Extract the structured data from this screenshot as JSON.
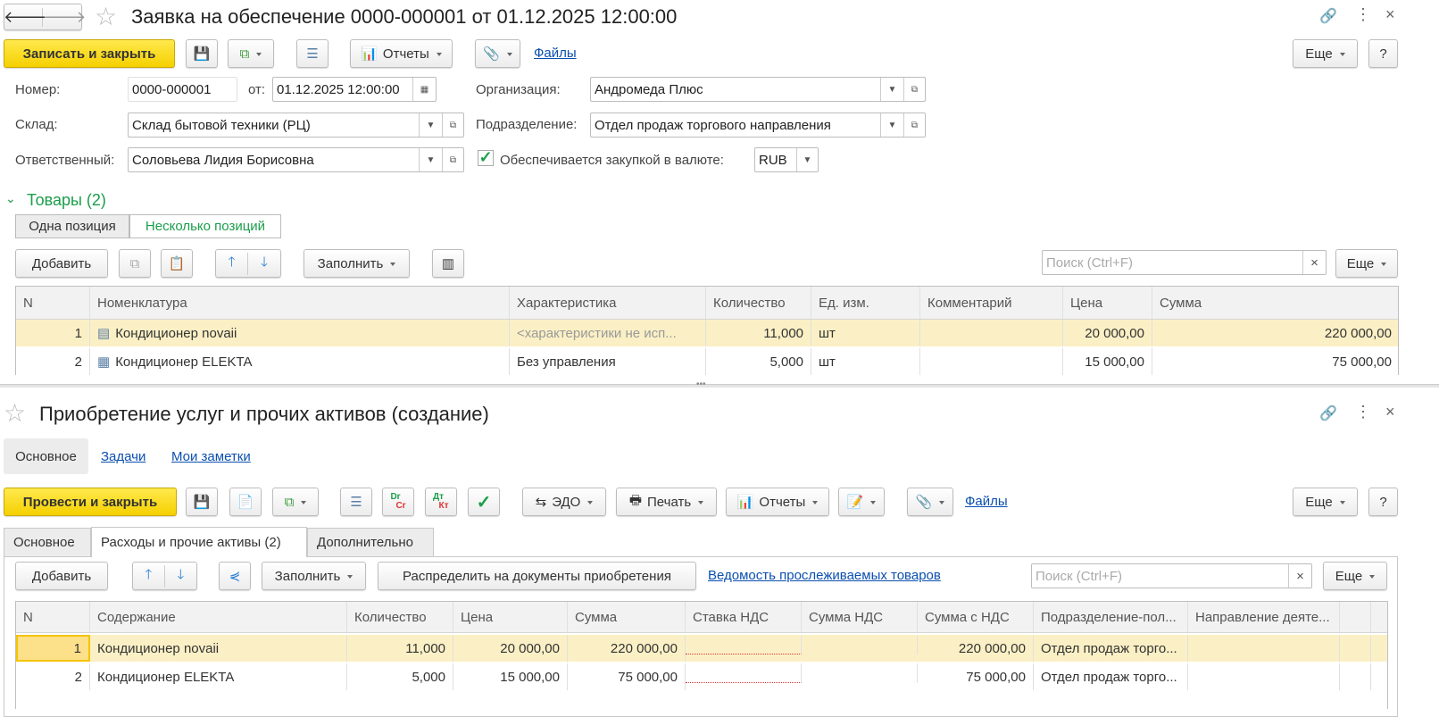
{
  "top": {
    "title": "Заявка на обеспечение 0000-000001 от 01.12.2025 12:00:00",
    "save_close": "Записать и закрыть",
    "reports": "Отчеты",
    "files": "Файлы",
    "more": "Еще",
    "help": "?",
    "fields": {
      "number_label": "Номер:",
      "number": "0000-000001",
      "from_label": "от:",
      "date": "01.12.2025 12:00:00",
      "org_label": "Организация:",
      "org": "Андромеда Плюс",
      "warehouse_label": "Склад:",
      "warehouse": "Склад бытовой техники (РЦ)",
      "dept_label": "Подразделение:",
      "dept": "Отдел продаж торгового направления",
      "resp_label": "Ответственный:",
      "resp": "Соловьева Лидия Борисовна",
      "purchase_label": "Обеспечивается закупкой в валюте:",
      "currency": "RUB"
    },
    "goods_title": "Товары (2)",
    "mode_one": "Одна позиция",
    "mode_many": "Несколько позиций",
    "add": "Добавить",
    "fill": "Заполнить",
    "search_placeholder": "Поиск (Ctrl+F)",
    "clear": "×",
    "columns": [
      "N",
      "Номенклатура",
      "Характеристика",
      "Количество",
      "Ед. изм.",
      "Комментарий",
      "Цена",
      "Сумма"
    ],
    "rows": [
      {
        "n": "1",
        "name": "Кондиционер novaii",
        "char": "<характеристики не исп...",
        "qty": "11,000",
        "unit": "шт",
        "comment": "",
        "price": "20 000,00",
        "sum": "220 000,00"
      },
      {
        "n": "2",
        "name": "Кондиционер ELEKTA",
        "char": "Без управления",
        "qty": "5,000",
        "unit": "шт",
        "comment": "",
        "price": "15 000,00",
        "sum": "75 000,00"
      }
    ]
  },
  "bottom": {
    "title": "Приобретение услуг и прочих активов (создание)",
    "sections": [
      "Основное",
      "Задачи",
      "Мои заметки"
    ],
    "post_close": "Провести и закрыть",
    "edo": "ЭДО",
    "print": "Печать",
    "reports": "Отчеты",
    "files": "Файлы",
    "more": "Еще",
    "help": "?",
    "drcr": {
      "a": "Dr",
      "b": "Cr"
    },
    "dtkt": {
      "a": "Дт",
      "b": "Кт"
    },
    "tabs": [
      "Основное",
      "Расходы и прочие активы (2)",
      "Дополнительно"
    ],
    "add": "Добавить",
    "fill": "Заполнить",
    "distribute": "Распределить на документы приобретения",
    "tracked_link": "Ведомость прослеживаемых товаров",
    "search_placeholder": "Поиск (Ctrl+F)",
    "clear": "×",
    "columns": [
      "N",
      "Содержание",
      "Количество",
      "Цена",
      "Сумма",
      "Ставка НДС",
      "Сумма НДС",
      "Сумма с НДС",
      "Подразделение-пол...",
      "Направление деяте..."
    ],
    "rows": [
      {
        "n": "1",
        "name": "Кондиционер novaii",
        "qty": "11,000",
        "price": "20 000,00",
        "sum": "220 000,00",
        "rate": "",
        "vat": "",
        "total": "220 000,00",
        "dept": "Отдел продаж торго...",
        "dir": ""
      },
      {
        "n": "2",
        "name": "Кондиционер ELEKTA",
        "qty": "5,000",
        "price": "15 000,00",
        "sum": "75 000,00",
        "rate": "",
        "vat": "",
        "total": "75 000,00",
        "dept": "Отдел продаж торго...",
        "dir": ""
      }
    ]
  },
  "colors": {
    "accent_yellow": "#f5d000",
    "selected_row": "#fbf0c5",
    "green": "#1a9e4a",
    "link": "#0b4fb0"
  }
}
